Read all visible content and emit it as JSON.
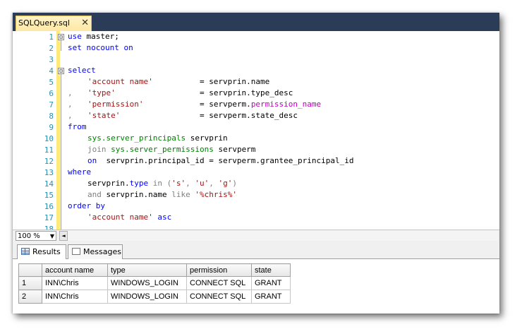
{
  "document_tab": {
    "title": "SQLQuery.sql",
    "close_glyph": "✕"
  },
  "line_numbers": [
    "1",
    "2",
    "3",
    "4",
    "5",
    "6",
    "7",
    "8",
    "9",
    "10",
    "11",
    "12",
    "13",
    "14",
    "15",
    "16",
    "17",
    "18"
  ],
  "code": {
    "l1_kw": "use",
    "l1_rest": " master;",
    "l2_kw1": "set",
    "l2_sp1": " ",
    "l2_kw2": "nocount",
    "l2_sp2": " ",
    "l2_kw3": "on",
    "l4_kw": "select",
    "l5_str": "'account name'",
    "l5_rest": "          = servprin.name",
    "l6_comma": ",",
    "l6_str": "'type'",
    "l6_rest": "                  = servprin.type_desc",
    "l7_comma": ",",
    "l7_str": "'permission'",
    "l7_rest": "            = servperm.",
    "l7_fn": "permission_name",
    "l8_comma": ",",
    "l8_str": "'state'",
    "l8_rest": "                 = servperm.state_desc",
    "l9_kw": "from",
    "l10_sys": "sys.server_principals",
    "l10_rest": " servprin",
    "l11_kw": "join",
    "l11_sys": "sys.server_permissions",
    "l11_rest": " servperm",
    "l12_kw": "on",
    "l12_rest": "  servprin.principal_id = servperm.grantee_principal_id",
    "l13_kw": "where",
    "l14_a": "servprin.",
    "l14_kw": "type",
    "l14_in": " in ",
    "l14_paren_open": "(",
    "l14_s1": "'s'",
    "l14_c1": ", ",
    "l14_s2": "'u'",
    "l14_c2": ", ",
    "l14_s3": "'g'",
    "l14_paren_close": ")",
    "l15_and": "and",
    "l15_mid": " servprin.name ",
    "l15_like": "like",
    "l15_sp": " ",
    "l15_str": "'%chris%'",
    "l16_kw": "order by",
    "l17_str": "'account name'",
    "l17_sp": " ",
    "l17_kw": "asc"
  },
  "fold_markers": [
    "⊟",
    "⊟"
  ],
  "status": {
    "zoom": "100 %",
    "zoom_arrow": "▼",
    "scroll_left_arrow": "◄"
  },
  "result_tabs": [
    {
      "label": "Results"
    },
    {
      "label": "Messages"
    }
  ],
  "results": {
    "columns": [
      "account name",
      "type",
      "permission",
      "state"
    ],
    "rows": [
      {
        "num": "1",
        "cells": [
          "INN\\Chris",
          "WINDOWS_LOGIN",
          "CONNECT SQL",
          "GRANT"
        ]
      },
      {
        "num": "2",
        "cells": [
          "INN\\Chris",
          "WINDOWS_LOGIN",
          "CONNECT SQL",
          "GRANT"
        ]
      }
    ]
  },
  "colors": {
    "tabstrip": "#2b3c59",
    "keyword": "#0000ff",
    "string": "#a31515",
    "system_object": "#008000",
    "function": "#c000c0",
    "line_number": "#2b91af"
  }
}
